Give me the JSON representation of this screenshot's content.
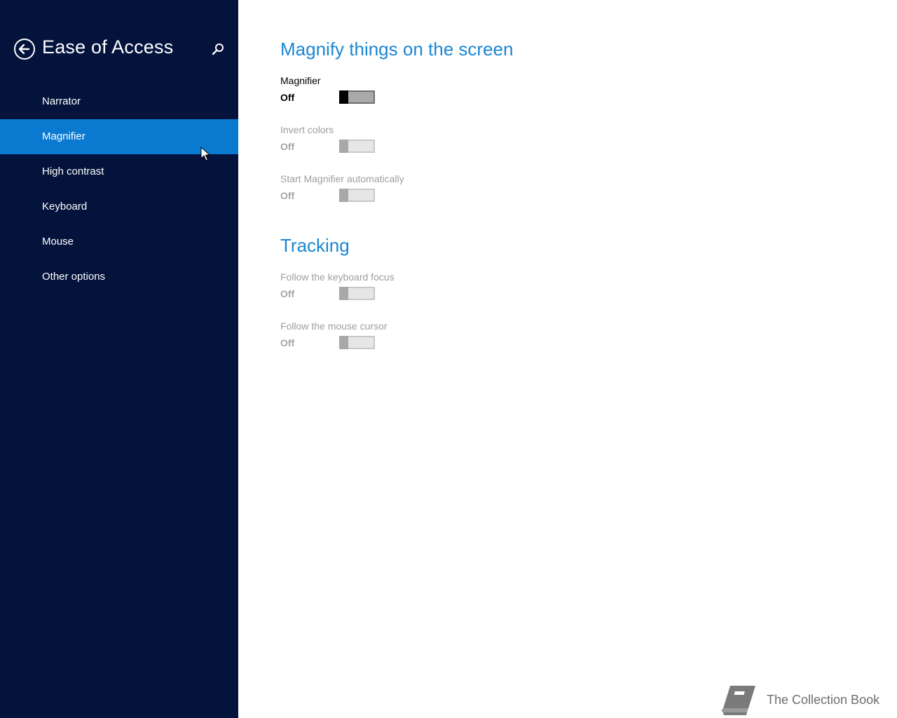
{
  "sidebar": {
    "title": "Ease of Access",
    "back_icon": "back-arrow-circle-icon",
    "search_icon": "search-icon",
    "items": [
      {
        "label": "Narrator",
        "selected": false
      },
      {
        "label": "Magnifier",
        "selected": true
      },
      {
        "label": "High contrast",
        "selected": false
      },
      {
        "label": "Keyboard",
        "selected": false
      },
      {
        "label": "Mouse",
        "selected": false
      },
      {
        "label": "Other options",
        "selected": false
      }
    ],
    "background_color": "#03133c",
    "selected_color": "#0a79d0"
  },
  "main": {
    "sections": [
      {
        "title": "Magnify things on the screen",
        "settings": [
          {
            "label": "Magnifier",
            "state": "Off",
            "enabled": true
          },
          {
            "label": "Invert colors",
            "state": "Off",
            "enabled": false
          },
          {
            "label": "Start Magnifier automatically",
            "state": "Off",
            "enabled": false
          }
        ]
      },
      {
        "title": "Tracking",
        "settings": [
          {
            "label": "Follow the keyboard focus",
            "state": "Off",
            "enabled": false
          },
          {
            "label": "Follow the mouse cursor",
            "state": "Off",
            "enabled": false
          }
        ]
      }
    ],
    "accent_color": "#1b86d2"
  },
  "watermark": {
    "text": "The Collection Book",
    "icon": "book-icon"
  }
}
